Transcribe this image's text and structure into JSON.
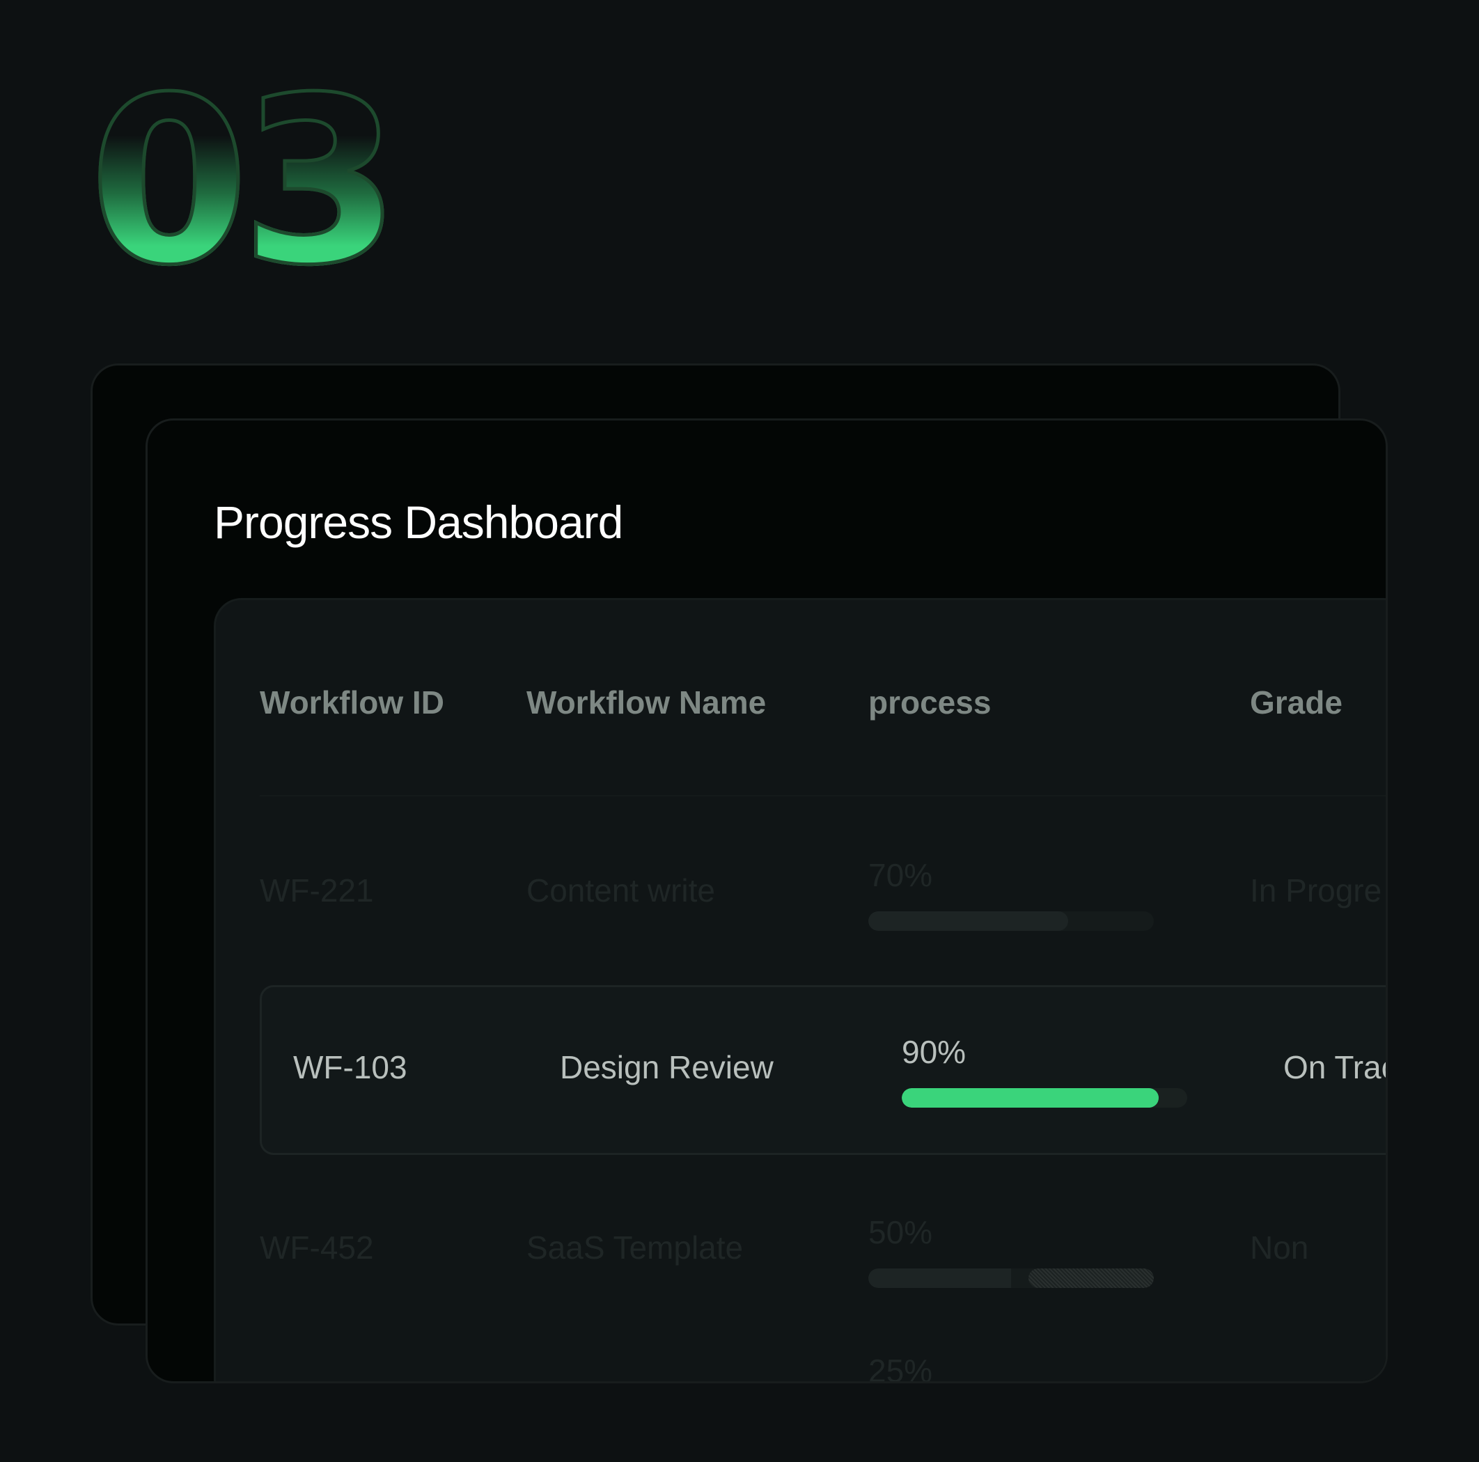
{
  "step_number": "03",
  "dashboard": {
    "title": "Progress Dashboard"
  },
  "table": {
    "columns": [
      "Workflow ID",
      "Workflow Name",
      "process",
      "Grade"
    ],
    "rows": [
      {
        "id": "WF-221",
        "name": "Content write",
        "progress_label": "70%",
        "progress": 0.7,
        "grade": "In Progre",
        "selected": false
      },
      {
        "id": "WF-103",
        "name": "Design Review",
        "progress_label": "90%",
        "progress": 0.9,
        "grade": "On Trac",
        "selected": true
      },
      {
        "id": "WF-452",
        "name": "SaaS Template",
        "progress_label": "50%",
        "progress": 0.5,
        "grade": "Non",
        "selected": false
      },
      {
        "progress_label": "25%"
      }
    ]
  },
  "colors": {
    "background": "#0d1112",
    "accent": "#3ad47b",
    "card": "#030605",
    "panel": "#101516"
  }
}
